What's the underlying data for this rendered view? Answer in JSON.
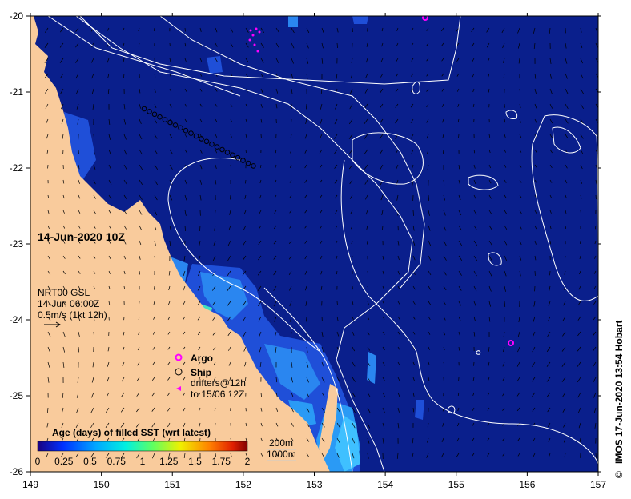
{
  "map": {
    "date_label": "14-Jun-2020 10Z",
    "info": {
      "line1": "NRT00 GSL",
      "line2": "14-Jun 06:00Z",
      "line3": "0.5m/s (1kt 12h)"
    },
    "x_ticks": [
      "149",
      "150",
      "151",
      "152",
      "153",
      "154",
      "155",
      "156",
      "157"
    ],
    "y_ticks": [
      "-20",
      "-21",
      "-22",
      "-23",
      "-24",
      "-25",
      "-26"
    ],
    "legend": {
      "argo": "Argo",
      "ship": "Ship",
      "drifters_line1": "drifters@12h",
      "drifters_line2": "to 15/06 12Z"
    },
    "colorbar": {
      "title": "Age (days) of filled SST (wrt latest)",
      "ticks": [
        "0",
        "0.25",
        "0.5",
        "0.75",
        "1",
        "1.25",
        "1.5",
        "1.75",
        "2"
      ]
    },
    "depth_legend": [
      "200m",
      "1000m"
    ],
    "credit": "IMOS 17-Jun-2020 13:54 Hobart",
    "copyright": "©",
    "colors": {
      "ocean": "#0a1f8c",
      "land": "#f9cb9c",
      "argo": "#ff00ff",
      "contour": "#ffffff"
    }
  }
}
